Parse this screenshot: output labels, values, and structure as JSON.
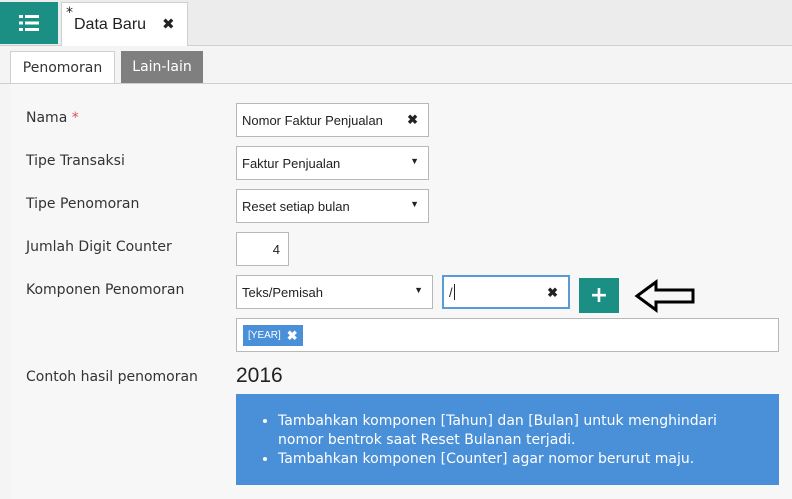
{
  "header": {
    "menu_icon": "list-icon",
    "tab": {
      "dirty_mark": "*",
      "title": "Data Baru",
      "close": "✖"
    }
  },
  "subtabs": [
    "Penomoran",
    "Lain-lain"
  ],
  "form": {
    "nama": {
      "label": "Nama",
      "required_mark": "*",
      "value": "Nomor Faktur Penjualan",
      "clear": "✖"
    },
    "tipe_transaksi": {
      "label": "Tipe Transaksi",
      "value": "Faktur Penjualan"
    },
    "tipe_penomoran": {
      "label": "Tipe Penomoran",
      "value": "Reset setiap bulan"
    },
    "jumlah_digit": {
      "label": "Jumlah Digit Counter",
      "value": "4"
    },
    "komponen": {
      "label": "Komponen Penomoran",
      "type_value": "Teks/Pemisah",
      "text_value": "/",
      "add_label": "+",
      "tags": [
        "[YEAR]"
      ]
    },
    "contoh": {
      "label": "Contoh hasil penomoran",
      "value": "2016"
    }
  },
  "info": {
    "items": [
      "Tambahkan komponen [Tahun] dan [Bulan] untuk menghindari nomor bentrok saat Reset Bulanan terjadi.",
      "Tambahkan komponen [Counter] agar nomor berurut maju."
    ]
  },
  "colors": {
    "accent": "#1b8f84",
    "info_bg": "#4a90d9",
    "required": "#d9534f"
  }
}
